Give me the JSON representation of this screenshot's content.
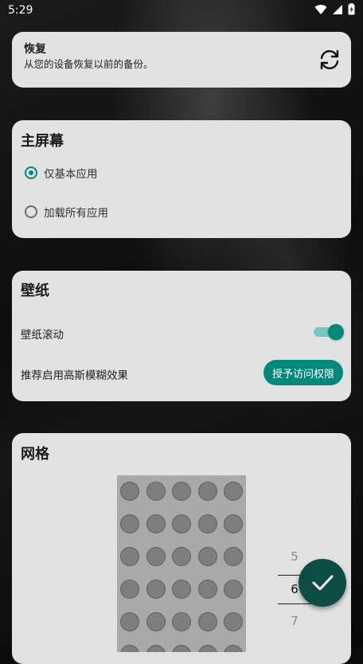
{
  "status_bar": {
    "time": "5:29"
  },
  "restore": {
    "title": "恢复",
    "subtitle": "从您的设备恢复以前的备份。",
    "icon": "sync-icon"
  },
  "home_screen": {
    "title": "主屏幕",
    "options": [
      {
        "label": "仅基本应用",
        "selected": true
      },
      {
        "label": "加载所有应用",
        "selected": false
      }
    ]
  },
  "wallpaper": {
    "title": "壁纸",
    "scroll_label": "壁纸滚动",
    "scroll_enabled": true,
    "blur_label": "推荐启用高斯模糊效果",
    "grant_button": "授予访问权限"
  },
  "grid": {
    "title": "网格",
    "columns": 5,
    "picker_values": [
      "5",
      "6",
      "7"
    ],
    "selected_value": "6"
  },
  "colors": {
    "accent": "#00897b",
    "fab": "#0c4c44",
    "card": "#e2e2e2"
  }
}
